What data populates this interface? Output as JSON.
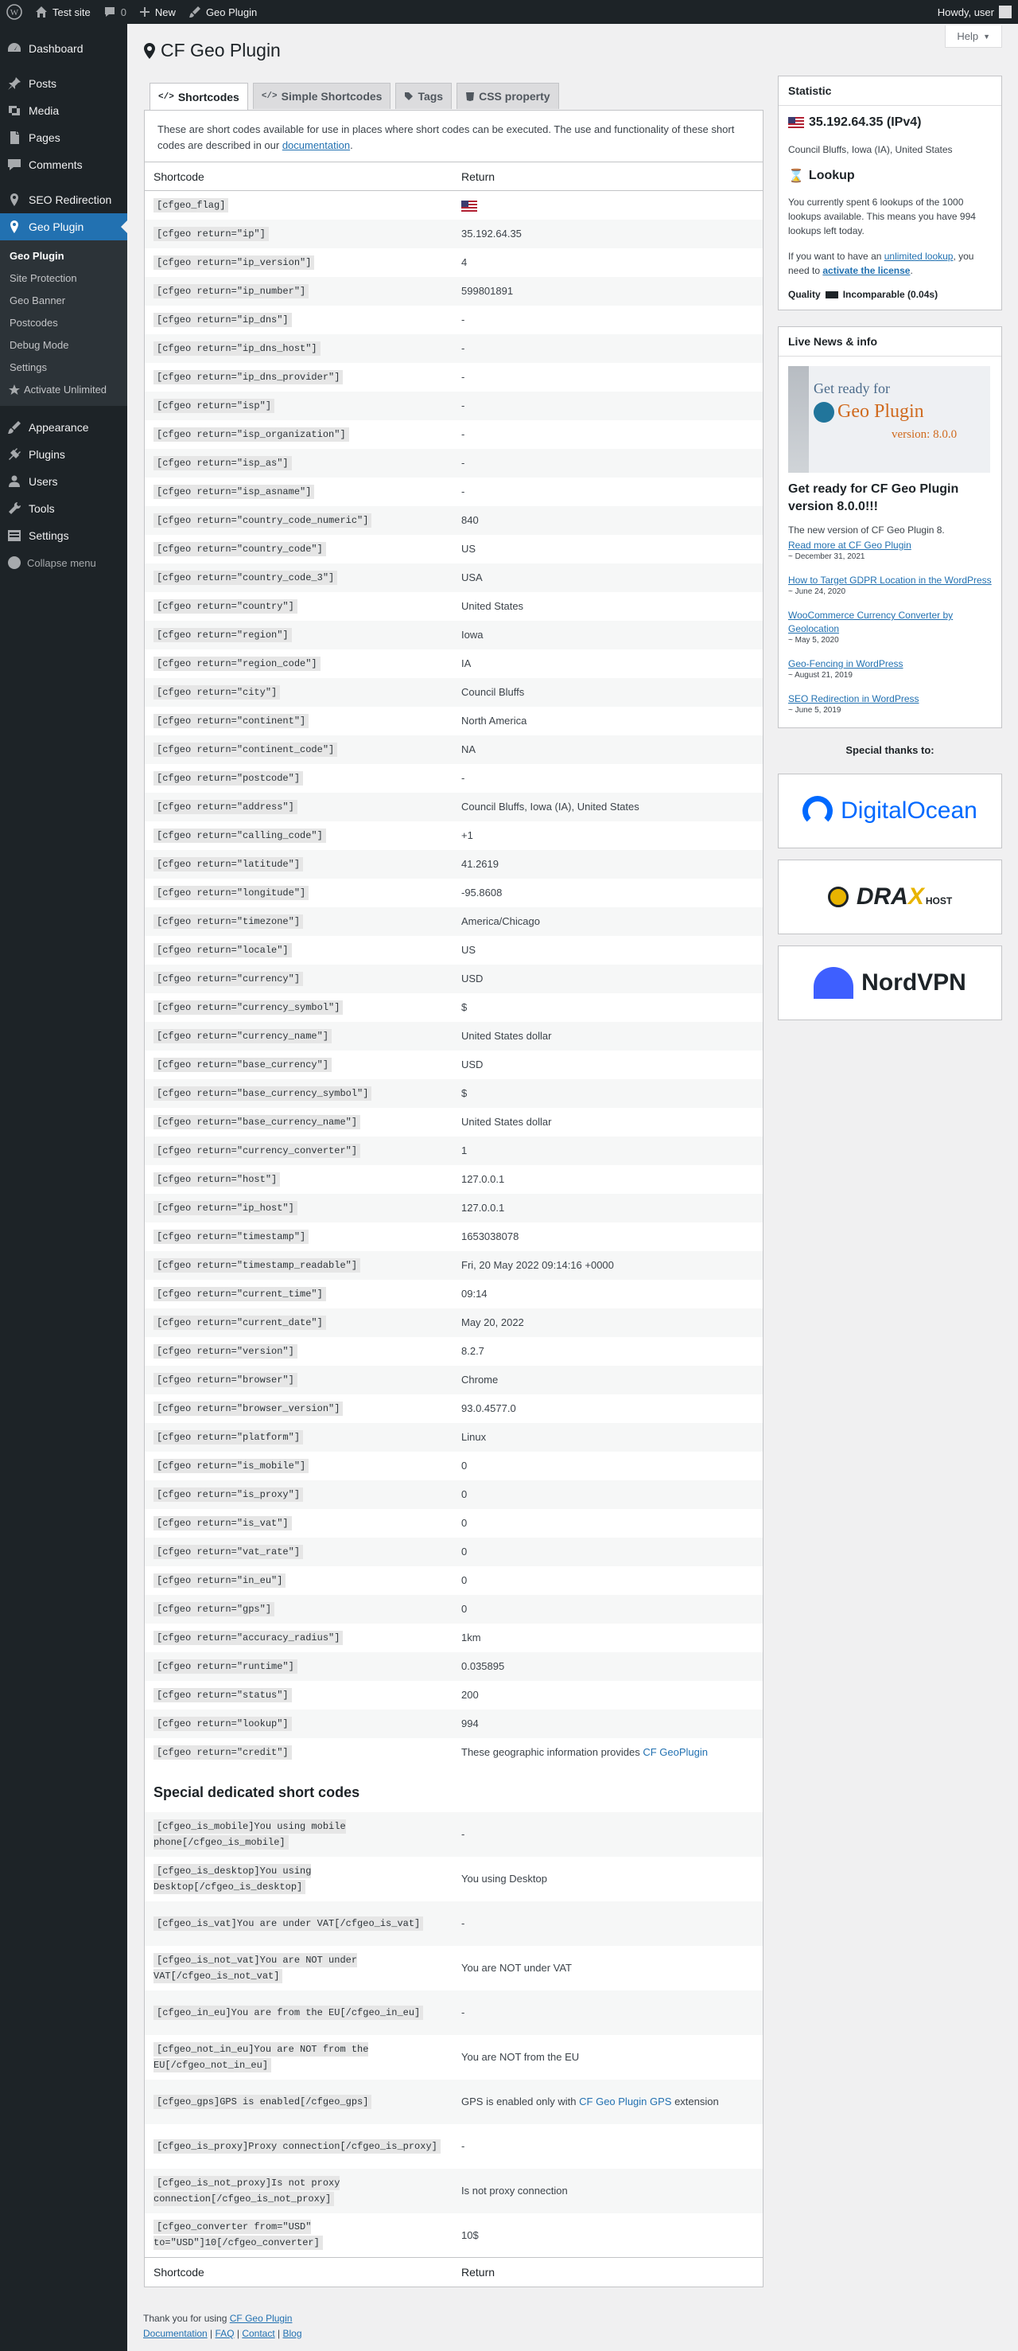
{
  "adminbar": {
    "site": "Test site",
    "comments": "0",
    "new": "New",
    "plugin": "Geo Plugin",
    "howdy": "Howdy, user"
  },
  "menu": {
    "top": [
      {
        "label": "Dashboard",
        "icon": "dashboard-icon"
      }
    ],
    "group1": [
      {
        "label": "Posts",
        "icon": "pin-icon"
      },
      {
        "label": "Media",
        "icon": "media-icon"
      },
      {
        "label": "Pages",
        "icon": "page-icon"
      },
      {
        "label": "Comments",
        "icon": "comment-icon"
      }
    ],
    "seo": "SEO Redirection",
    "geo": "Geo Plugin",
    "sub": [
      "Geo Plugin",
      "Site Protection",
      "Geo Banner",
      "Postcodes",
      "Debug Mode",
      "Settings",
      "Activate Unlimited"
    ],
    "group2": [
      {
        "label": "Appearance",
        "icon": "brush-icon"
      },
      {
        "label": "Plugins",
        "icon": "plug-icon"
      },
      {
        "label": "Users",
        "icon": "users-icon"
      },
      {
        "label": "Tools",
        "icon": "wrench-icon"
      },
      {
        "label": "Settings",
        "icon": "settings-icon"
      }
    ],
    "collapse": "Collapse menu"
  },
  "help": "Help",
  "title": "CF Geo Plugin",
  "tabs": [
    "Shortcodes",
    "Simple Shortcodes",
    "Tags",
    "CSS property"
  ],
  "intro": {
    "text": "These are short codes available for use in places where short codes can be executed. The use and functionality of these short codes are described in our ",
    "link": "documentation",
    "end": "."
  },
  "table": {
    "col1": "Shortcode",
    "col2": "Return"
  },
  "rows": [
    [
      "[cfgeo_flag]",
      "__flag__"
    ],
    [
      "[cfgeo return=\"ip\"]",
      "35.192.64.35"
    ],
    [
      "[cfgeo return=\"ip_version\"]",
      "4"
    ],
    [
      "[cfgeo return=\"ip_number\"]",
      "599801891"
    ],
    [
      "[cfgeo return=\"ip_dns\"]",
      "-"
    ],
    [
      "[cfgeo return=\"ip_dns_host\"]",
      "-"
    ],
    [
      "[cfgeo return=\"ip_dns_provider\"]",
      "-"
    ],
    [
      "[cfgeo return=\"isp\"]",
      "-"
    ],
    [
      "[cfgeo return=\"isp_organization\"]",
      "-"
    ],
    [
      "[cfgeo return=\"isp_as\"]",
      "-"
    ],
    [
      "[cfgeo return=\"isp_asname\"]",
      "-"
    ],
    [
      "[cfgeo return=\"country_code_numeric\"]",
      "840"
    ],
    [
      "[cfgeo return=\"country_code\"]",
      "US"
    ],
    [
      "[cfgeo return=\"country_code_3\"]",
      "USA"
    ],
    [
      "[cfgeo return=\"country\"]",
      "United States"
    ],
    [
      "[cfgeo return=\"region\"]",
      "Iowa"
    ],
    [
      "[cfgeo return=\"region_code\"]",
      "IA"
    ],
    [
      "[cfgeo return=\"city\"]",
      "Council Bluffs"
    ],
    [
      "[cfgeo return=\"continent\"]",
      "North America"
    ],
    [
      "[cfgeo return=\"continent_code\"]",
      "NA"
    ],
    [
      "[cfgeo return=\"postcode\"]",
      "-"
    ],
    [
      "[cfgeo return=\"address\"]",
      "Council Bluffs, Iowa (IA), United States"
    ],
    [
      "[cfgeo return=\"calling_code\"]",
      "+1"
    ],
    [
      "[cfgeo return=\"latitude\"]",
      "41.2619"
    ],
    [
      "[cfgeo return=\"longitude\"]",
      "-95.8608"
    ],
    [
      "[cfgeo return=\"timezone\"]",
      "America/Chicago"
    ],
    [
      "[cfgeo return=\"locale\"]",
      "US"
    ],
    [
      "[cfgeo return=\"currency\"]",
      "USD"
    ],
    [
      "[cfgeo return=\"currency_symbol\"]",
      "$"
    ],
    [
      "[cfgeo return=\"currency_name\"]",
      "United States dollar"
    ],
    [
      "[cfgeo return=\"base_currency\"]",
      "USD"
    ],
    [
      "[cfgeo return=\"base_currency_symbol\"]",
      "$"
    ],
    [
      "[cfgeo return=\"base_currency_name\"]",
      "United States dollar"
    ],
    [
      "[cfgeo return=\"currency_converter\"]",
      "1"
    ],
    [
      "[cfgeo return=\"host\"]",
      "127.0.0.1"
    ],
    [
      "[cfgeo return=\"ip_host\"]",
      "127.0.0.1"
    ],
    [
      "[cfgeo return=\"timestamp\"]",
      "1653038078"
    ],
    [
      "[cfgeo return=\"timestamp_readable\"]",
      "Fri, 20 May 2022 09:14:16 +0000"
    ],
    [
      "[cfgeo return=\"current_time\"]",
      "09:14"
    ],
    [
      "[cfgeo return=\"current_date\"]",
      "May 20, 2022"
    ],
    [
      "[cfgeo return=\"version\"]",
      "8.2.7"
    ],
    [
      "[cfgeo return=\"browser\"]",
      "Chrome"
    ],
    [
      "[cfgeo return=\"browser_version\"]",
      "93.0.4577.0"
    ],
    [
      "[cfgeo return=\"platform\"]",
      "Linux"
    ],
    [
      "[cfgeo return=\"is_mobile\"]",
      "0"
    ],
    [
      "[cfgeo return=\"is_proxy\"]",
      "0"
    ],
    [
      "[cfgeo return=\"is_vat\"]",
      "0"
    ],
    [
      "[cfgeo return=\"vat_rate\"]",
      "0"
    ],
    [
      "[cfgeo return=\"in_eu\"]",
      "0"
    ],
    [
      "[cfgeo return=\"gps\"]",
      "0"
    ],
    [
      "[cfgeo return=\"accuracy_radius\"]",
      "1km"
    ],
    [
      "[cfgeo return=\"runtime\"]",
      "0.035895"
    ],
    [
      "[cfgeo return=\"status\"]",
      "200"
    ],
    [
      "[cfgeo return=\"lookup\"]",
      "994"
    ],
    [
      "[cfgeo return=\"credit\"]",
      "__credit__"
    ]
  ],
  "credit": {
    "text": "These geographic information provides ",
    "link": "CF GeoPlugin"
  },
  "special": {
    "heading": "Special dedicated short codes",
    "rows": [
      [
        "[cfgeo_is_mobile]You using mobile phone[/cfgeo_is_mobile]",
        "-"
      ],
      [
        "[cfgeo_is_desktop]You using Desktop[/cfgeo_is_desktop]",
        "You using Desktop"
      ],
      [
        "[cfgeo_is_vat]You are under VAT[/cfgeo_is_vat]",
        "-"
      ],
      [
        "[cfgeo_is_not_vat]You are NOT under VAT[/cfgeo_is_not_vat]",
        "You are NOT under VAT"
      ],
      [
        "[cfgeo_in_eu]You are from the EU[/cfgeo_in_eu]",
        "-"
      ],
      [
        "[cfgeo_not_in_eu]You are NOT from the EU[/cfgeo_not_in_eu]",
        "You are NOT from the EU"
      ],
      [
        "[cfgeo_gps]GPS is enabled[/cfgeo_gps]",
        "__gps__"
      ],
      [
        "[cfgeo_is_proxy]Proxy connection[/cfgeo_is_proxy]",
        "-"
      ],
      [
        "[cfgeo_is_not_proxy]Is not proxy connection[/cfgeo_is_not_proxy]",
        "Is not proxy connection"
      ],
      [
        "[cfgeo_converter from=\"USD\" to=\"USD\"]10[/cfgeo_converter]",
        "10$"
      ]
    ],
    "gps": {
      "pre": "GPS is enabled only with ",
      "link": "CF Geo Plugin GPS",
      "post": " extension"
    }
  },
  "statistic": {
    "title": "Statistic",
    "ip": "35.192.64.35 (IPv4)",
    "location": "Council Bluffs, Iowa (IA), United States",
    "lookup_title": "Lookup",
    "lookup_text": "You currently spent 6 lookups of the 1000 lookups available. This means you have 994 lookups left today.",
    "unl_pre": "If you want to have an ",
    "unl_link": "unlimited lookup",
    "unl_mid": ", you need to ",
    "unl_act": "activate the license",
    "unl_end": ".",
    "quality_label": "Quality",
    "quality_value": "Incomparable (0.04s)"
  },
  "news": {
    "title": "Live News & info",
    "img_line1": "Get ready for",
    "img_line2": "Geo Plugin",
    "img_line3": "version: 8.0.0",
    "headline": "Get ready for CF Geo Plugin version 8.0.0!!!",
    "lead": "The new version of CF Geo Plugin 8.",
    "readmore": "Read more at CF Geo Plugin",
    "lead_date": "~ December 31, 2021",
    "items": [
      {
        "title": "How to Target GDPR Location in the WordPress",
        "date": "~ June 24, 2020"
      },
      {
        "title": "WooCommerce Currency Converter by Geolocation",
        "date": "~ May 5, 2020"
      },
      {
        "title": "Geo-Fencing in WordPress",
        "date": "~ August 21, 2019"
      },
      {
        "title": "SEO Redirection in WordPress",
        "date": "~ June 5, 2019"
      }
    ]
  },
  "thanks": "Special thanks to:",
  "sponsors": {
    "do": "DigitalOcean",
    "dx1": "DRA",
    "dx2": "X",
    "dx3": "HOST",
    "nv": "NordVPN"
  },
  "footer": {
    "pre": "Thank you for using ",
    "link": "CF Geo Plugin",
    "links": [
      "Documentation",
      "FAQ",
      "Contact",
      "Blog"
    ]
  }
}
